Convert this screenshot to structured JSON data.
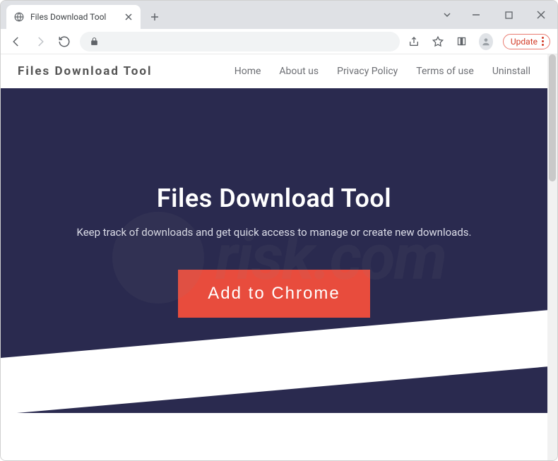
{
  "browser": {
    "tab_title": "Files Download Tool",
    "update_label": "Update"
  },
  "site": {
    "logo": "Files Download Tool",
    "nav": [
      "Home",
      "About us",
      "Privacy Policy",
      "Terms of use",
      "Uninstall"
    ]
  },
  "hero": {
    "title": "Files Download Tool",
    "subtitle": "Keep track of downloads and get quick access to manage or create new downloads.",
    "cta": "Add to Chrome"
  },
  "watermark": "risk.com"
}
